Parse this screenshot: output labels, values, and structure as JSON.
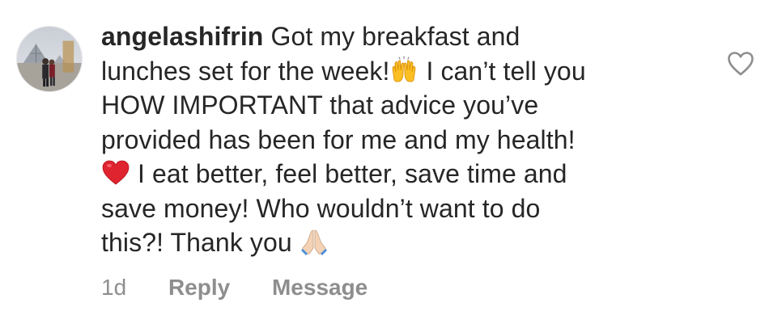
{
  "comment": {
    "username": "angelashifrin",
    "lines": [
      "Got my breakfast and",
      "lunches set for the week!",
      " I can’t tell you",
      "HOW IMPORTANT that advice you’ve",
      "provided has been for me and my health!",
      " I eat better, feel better, save time and",
      "save money! Who wouldn’t want to do",
      "this?! Thank you "
    ],
    "emojis": [
      "raising-hands",
      "red-heart",
      "folded-hands"
    ],
    "timestamp": "1d",
    "reply_label": "Reply",
    "message_label": "Message"
  },
  "colors": {
    "text": "#262626",
    "meta": "#8e8e8e",
    "heart": "#e0242f"
  }
}
